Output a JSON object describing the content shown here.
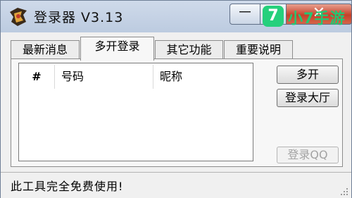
{
  "window": {
    "title": "登录器 V3.13",
    "controls": {
      "minimize": "－",
      "maximize": "□",
      "close": "✕"
    }
  },
  "watermark": {
    "badge": "7",
    "text": "小7手游"
  },
  "tabs": [
    {
      "label": "最新消息",
      "active": false
    },
    {
      "label": "多开登录",
      "active": true
    },
    {
      "label": "其它功能",
      "active": false
    },
    {
      "label": "重要说明",
      "active": false
    }
  ],
  "list": {
    "columns": [
      "#",
      "号码",
      "昵称"
    ],
    "rows": []
  },
  "buttons": {
    "multi_open": "多开",
    "login_hall": "登录大厅",
    "login_qq": "登录QQ"
  },
  "status": {
    "text": "此工具完全免费使用!"
  }
}
